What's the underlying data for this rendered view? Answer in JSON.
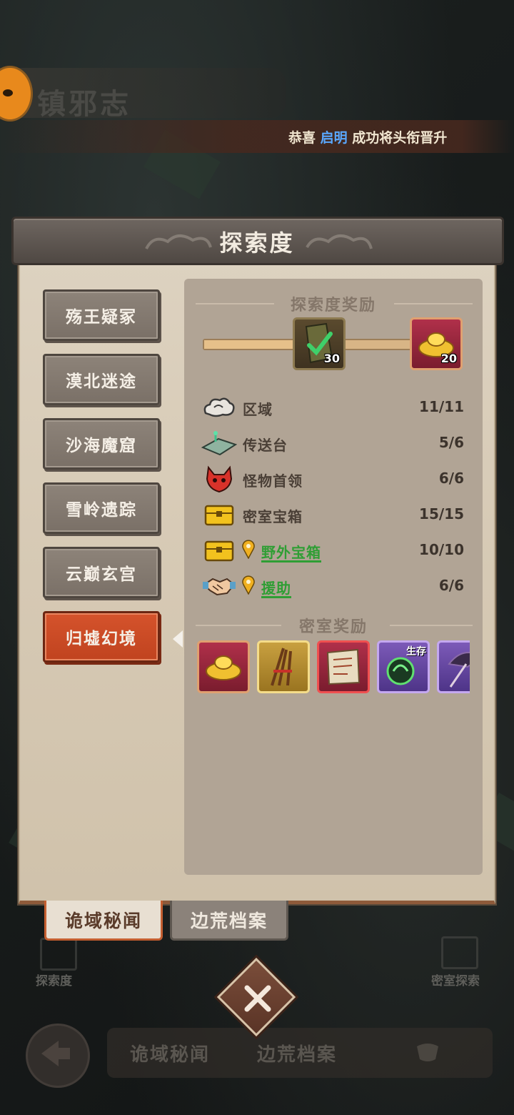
{
  "background": {
    "game_title": "镇邪志",
    "announcement": {
      "prefix": "恭喜",
      "player": "启明",
      "suffix": "成功将头衔晋升"
    },
    "shortcut_left": "探索度",
    "shortcut_right": "密室探索",
    "bottom_tabs": [
      "诡域秘闻",
      "边荒档案"
    ]
  },
  "panel": {
    "title": "探索度",
    "regions": [
      {
        "label": "殇王疑冢",
        "active": false
      },
      {
        "label": "漠北迷途",
        "active": false
      },
      {
        "label": "沙海魔窟",
        "active": false
      },
      {
        "label": "雪岭遗踪",
        "active": false
      },
      {
        "label": "云巅玄宫",
        "active": false
      },
      {
        "label": "归墟幻境",
        "active": true
      }
    ],
    "exploration_rewards": {
      "title": "探索度奖励",
      "progress": 0.45,
      "items": [
        {
          "icon": "scroll-check-icon",
          "count": "30"
        },
        {
          "icon": "gold-ingot-icon",
          "count": "20"
        }
      ]
    },
    "stats": [
      {
        "icon": "cloud-icon",
        "label": "区域",
        "value": "11/11",
        "locate": false
      },
      {
        "icon": "teleport-platform-icon",
        "label": "传送台",
        "value": "5/6",
        "locate": false
      },
      {
        "icon": "demon-head-icon",
        "label": "怪物首领",
        "value": "6/6",
        "locate": false
      },
      {
        "icon": "treasure-chest-icon",
        "label": "密室宝箱",
        "value": "15/15",
        "locate": false
      },
      {
        "icon": "treasure-chest-icon",
        "label": "野外宝箱",
        "value": "10/10",
        "locate": true
      },
      {
        "icon": "handshake-icon",
        "label": "援助",
        "value": "6/6",
        "locate": true
      }
    ],
    "chamber_rewards": {
      "title": "密室奖励",
      "items": [
        {
          "icon": "gold-ingot-icon",
          "frame": "red",
          "tag": ""
        },
        {
          "icon": "incense-sticks-icon",
          "frame": "gold",
          "tag": ""
        },
        {
          "icon": "old-map-icon",
          "frame": "red",
          "tag": ""
        },
        {
          "icon": "green-orb-icon",
          "frame": "purple",
          "tag": "生存"
        },
        {
          "icon": "umbrella-weapon-icon",
          "frame": "purple",
          "tag": ""
        }
      ]
    },
    "tabs": [
      {
        "label": "诡域秘闻",
        "active": true
      },
      {
        "label": "边荒档案",
        "active": false
      }
    ]
  },
  "colors": {
    "active_region": "#c8492a",
    "location_label": "#2f9e34",
    "highlight_name": "#5aa8ff"
  }
}
